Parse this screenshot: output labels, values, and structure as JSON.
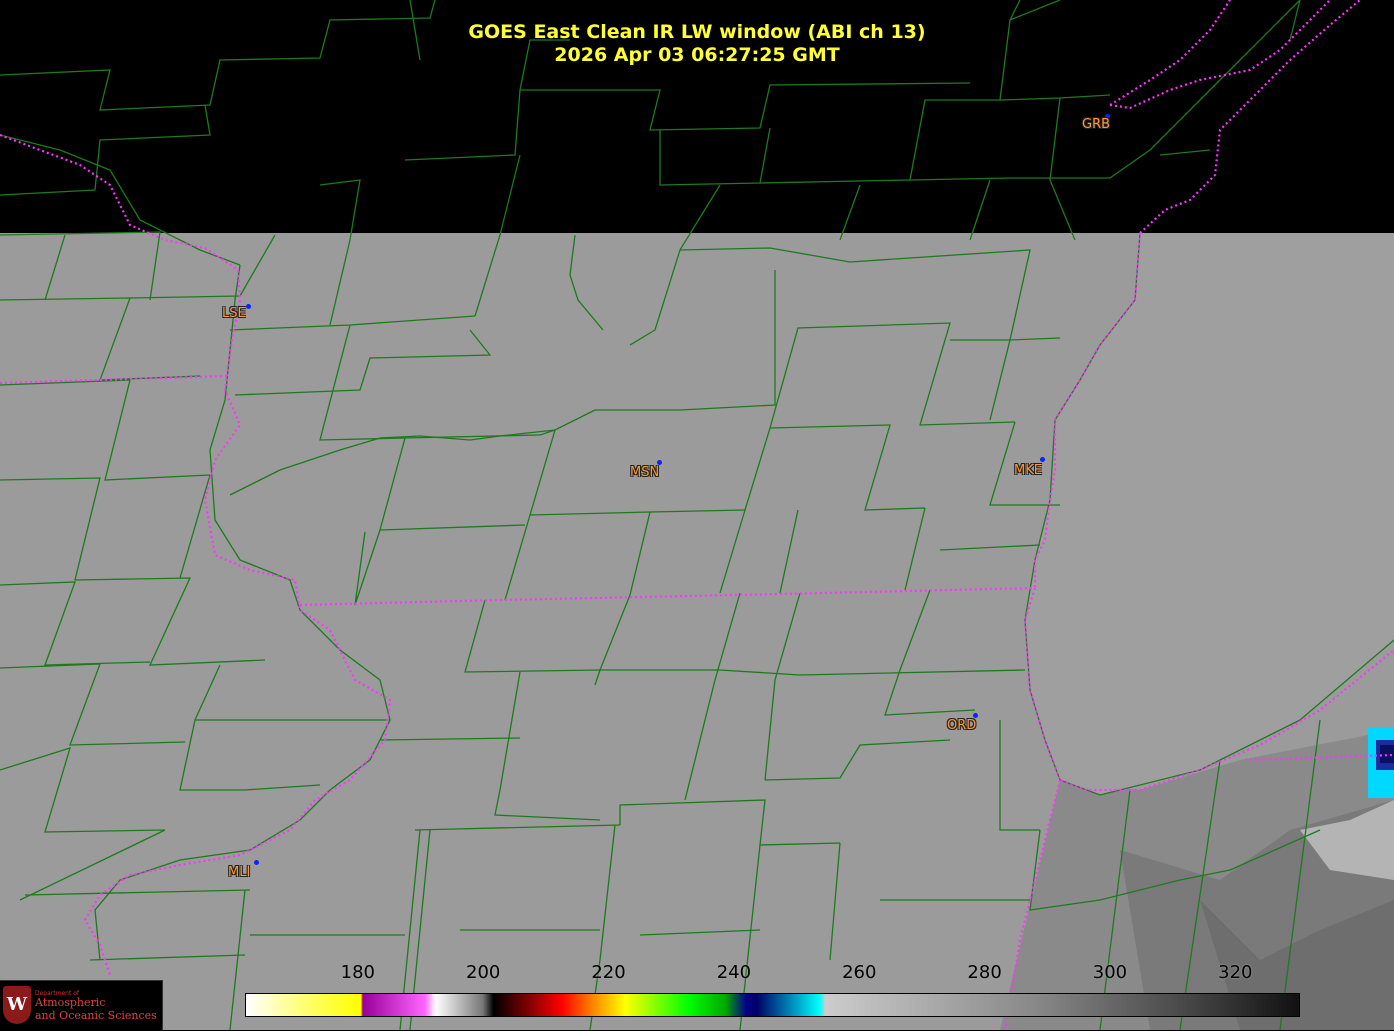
{
  "header": {
    "title": "GOES East Clean IR LW window (ABI ch 13)",
    "timestamp": "2026 Apr 03  06:27:25 GMT"
  },
  "stations": [
    {
      "id": "GRB"
    },
    {
      "id": "LSE"
    },
    {
      "id": "MSN"
    },
    {
      "id": "MKE"
    },
    {
      "id": "ORD"
    },
    {
      "id": "MLI"
    }
  ],
  "colorbar": {
    "ticks": [
      "180",
      "200",
      "220",
      "240",
      "260",
      "280",
      "300",
      "320"
    ],
    "range": [
      162,
      330
    ]
  },
  "logo": {
    "crest": "W",
    "dept": "Department of",
    "line1": "Atmospheric",
    "line2": "and Oceanic Sciences"
  },
  "colors": {
    "counties": "#1e7a1e",
    "state_borders": "#ff33ff",
    "title": "#ffff33",
    "station_label": "#ff9933"
  }
}
